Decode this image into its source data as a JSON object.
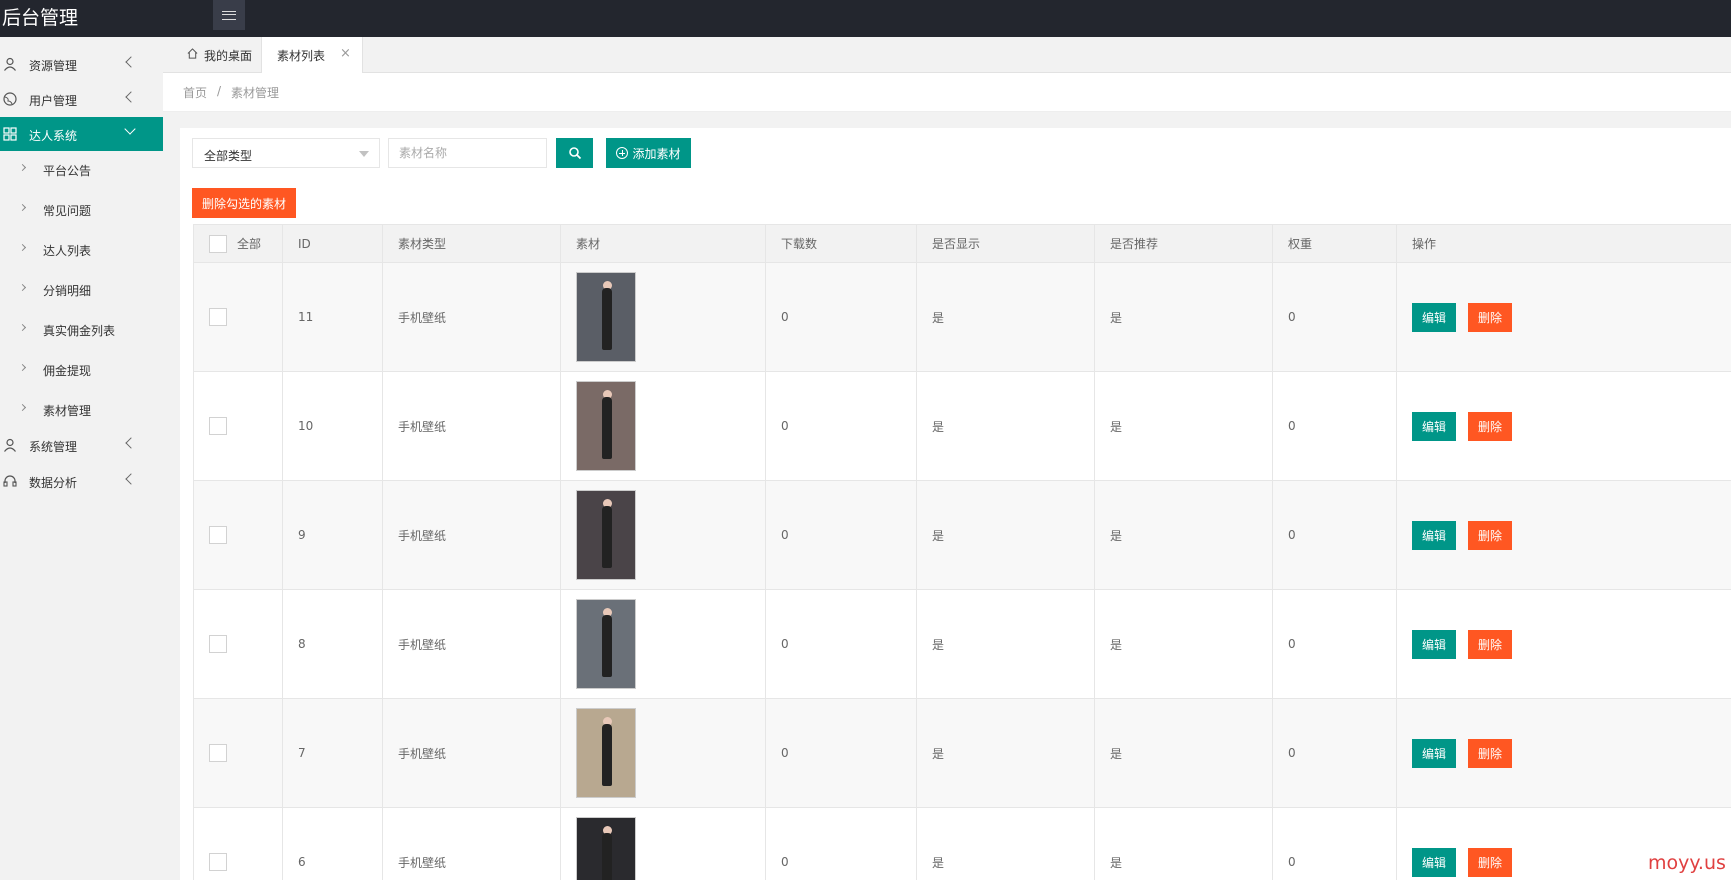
{
  "app": {
    "title": "后台管理"
  },
  "sidebar": {
    "items": [
      {
        "label": "资源管理",
        "icon": "user-icon"
      },
      {
        "label": "用户管理",
        "icon": "globe-icon"
      },
      {
        "label": "达人系统",
        "icon": "grid-icon",
        "active": true
      },
      {
        "label": "系统管理",
        "icon": "user-icon"
      },
      {
        "label": "数据分析",
        "icon": "headset-icon"
      }
    ],
    "sub_items": [
      {
        "label": "平台公告"
      },
      {
        "label": "常见问题"
      },
      {
        "label": "达人列表"
      },
      {
        "label": "分销明细"
      },
      {
        "label": "真实佣金列表"
      },
      {
        "label": "佣金提现"
      },
      {
        "label": "素材管理"
      }
    ]
  },
  "tabs": {
    "home": "我的桌面",
    "current": "素材列表",
    "close_glyph": "×"
  },
  "breadcrumb": {
    "home": "首页",
    "sep": "/",
    "current": "素材管理"
  },
  "filters": {
    "type_select": "全部类型",
    "name_placeholder": "素材名称",
    "add_label": "添加素材",
    "delete_selected_label": "删除勾选的素材"
  },
  "table": {
    "headers": {
      "all": "全部",
      "id": "ID",
      "type": "素材类型",
      "material": "素材",
      "downloads": "下载数",
      "show": "是否显示",
      "recommend": "是否推荐",
      "weight": "权重",
      "ops": "操作"
    },
    "rows": [
      {
        "id": "11",
        "type": "手机壁纸",
        "downloads": "0",
        "show": "是",
        "recommend": "是",
        "weight": "0",
        "thumb_bg": "#5a5e66"
      },
      {
        "id": "10",
        "type": "手机壁纸",
        "downloads": "0",
        "show": "是",
        "recommend": "是",
        "weight": "0",
        "thumb_bg": "#7a6a66"
      },
      {
        "id": "9",
        "type": "手机壁纸",
        "downloads": "0",
        "show": "是",
        "recommend": "是",
        "weight": "0",
        "thumb_bg": "#4a4448"
      },
      {
        "id": "8",
        "type": "手机壁纸",
        "downloads": "0",
        "show": "是",
        "recommend": "是",
        "weight": "0",
        "thumb_bg": "#6a7078"
      },
      {
        "id": "7",
        "type": "手机壁纸",
        "downloads": "0",
        "show": "是",
        "recommend": "是",
        "weight": "0",
        "thumb_bg": "#b8a890"
      },
      {
        "id": "6",
        "type": "手机壁纸",
        "downloads": "0",
        "show": "是",
        "recommend": "是",
        "weight": "0",
        "thumb_bg": "#2a2a2e"
      }
    ],
    "edit_label": "编辑",
    "delete_label": "删除"
  },
  "watermark": "moyy.us",
  "colors": {
    "accent": "#009688",
    "danger": "#ff5722",
    "topbar": "#23262e"
  }
}
